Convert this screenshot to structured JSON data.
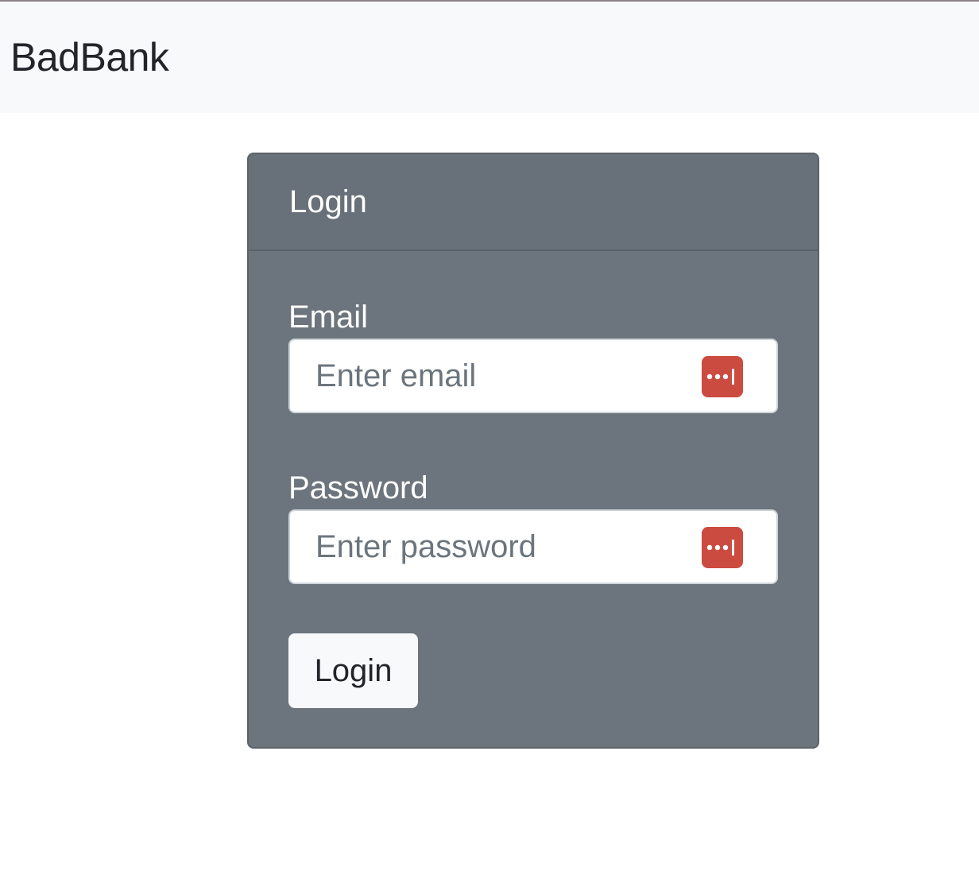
{
  "navbar": {
    "brand": "BadBank"
  },
  "login_card": {
    "header": "Login",
    "email": {
      "label": "Email",
      "placeholder": "Enter email",
      "value": ""
    },
    "password": {
      "label": "Password",
      "placeholder": "Enter password",
      "value": ""
    },
    "submit_label": "Login",
    "autofill_icon": "password-manager-icon"
  },
  "colors": {
    "navbar_bg": "#f8f9fa",
    "card_bg": "#6c757d",
    "autofill_icon": "#cc4b41",
    "button_bg": "#f8f9fa"
  }
}
